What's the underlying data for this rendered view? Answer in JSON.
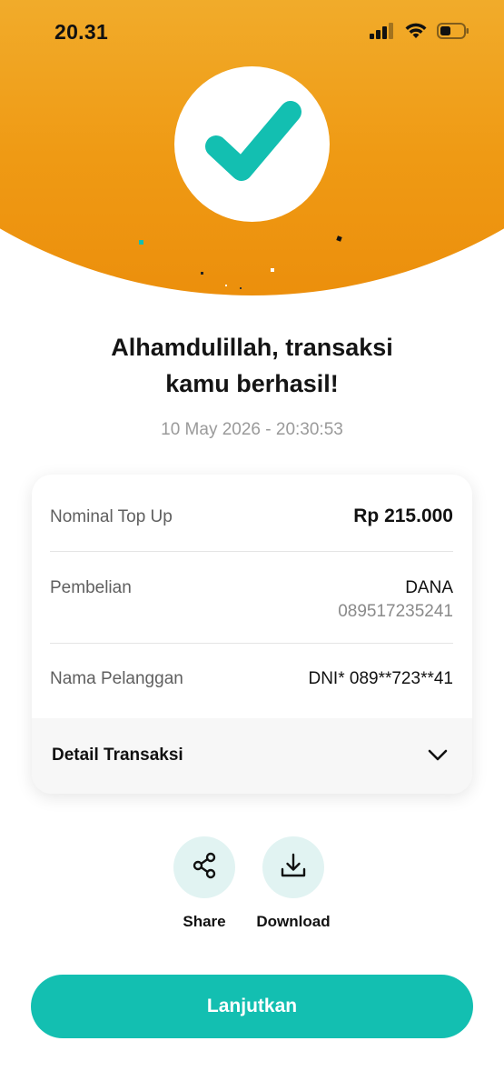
{
  "status_bar": {
    "time": "20.31",
    "icons": [
      "signal-icon",
      "wifi-icon",
      "battery-icon"
    ]
  },
  "hero": {
    "icon": "checkmark-icon",
    "colors": {
      "orange_top": "#f2b233",
      "orange_bottom": "#ec8f0c",
      "check": "#13bfb1"
    }
  },
  "result": {
    "title_line1": "Alhamdulillah, transaksi",
    "title_line2": "kamu berhasil!",
    "datetime": "10 May 2026 - 20:30:53"
  },
  "details": {
    "nominal_label": "Nominal Top Up",
    "nominal_value": "Rp 215.000",
    "pembelian_label": "Pembelian",
    "pembelian_value": "DANA",
    "pembelian_number": "089517235241",
    "nama_label": "Nama Pelanggan",
    "nama_value": "DNI* 089**723**41",
    "detail_toggle_label": "Detail Transaksi"
  },
  "actions": {
    "share_label": "Share",
    "download_label": "Download"
  },
  "continue_button": {
    "label": "Lanjutkan",
    "color": "#13bfb1"
  }
}
